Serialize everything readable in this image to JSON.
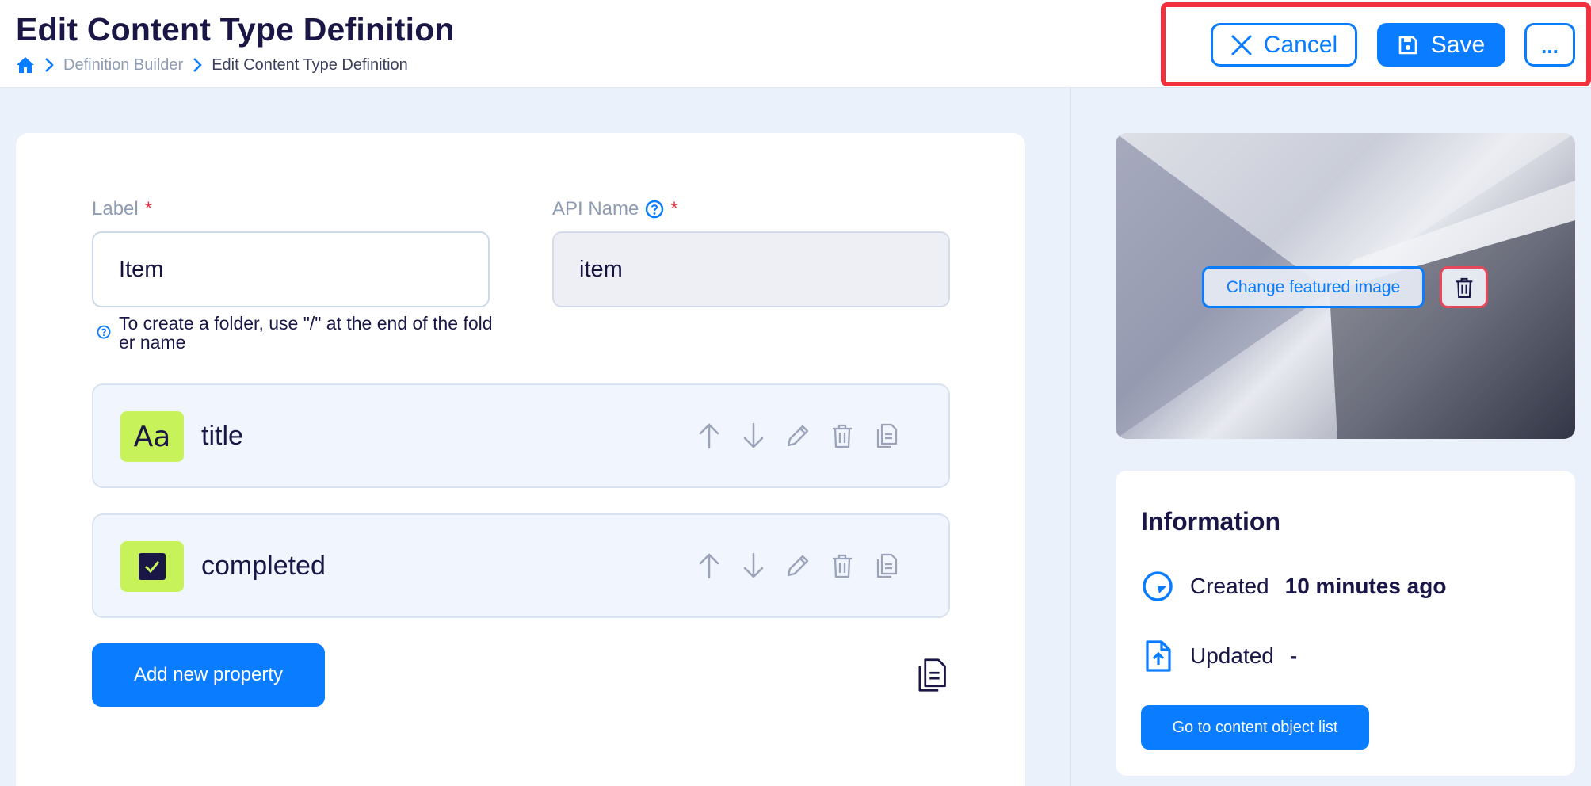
{
  "header": {
    "title": "Edit Content Type Definition",
    "breadcrumb": [
      "Definition Builder",
      "Edit Content Type Definition"
    ],
    "actions": {
      "cancel_label": "Cancel",
      "save_label": "Save",
      "more_label": "..."
    }
  },
  "form": {
    "label_field": {
      "label": "Label",
      "required_mark": "*",
      "value": "Item"
    },
    "api_field": {
      "label": "API Name",
      "required_mark": "*",
      "value": "item"
    },
    "hint": "To create a folder, use \"/\" at the end of the folder name"
  },
  "properties": [
    {
      "name": "title",
      "icon": "text-type-icon",
      "icon_text": "Aa"
    },
    {
      "name": "completed",
      "icon": "checkbox-type-icon"
    }
  ],
  "add_property_label": "Add new property",
  "sidebar": {
    "change_image_label": "Change featured image",
    "info": {
      "title": "Information",
      "created_label": "Created",
      "created_value": "10 minutes ago",
      "updated_label": "Updated",
      "updated_value": "-",
      "goto_label": "Go to content object list"
    }
  },
  "colors": {
    "accent": "#0a7cff",
    "highlight_frame": "#f2303e",
    "property_icon_bg": "#c8f25a",
    "title_text": "#1a1747"
  }
}
